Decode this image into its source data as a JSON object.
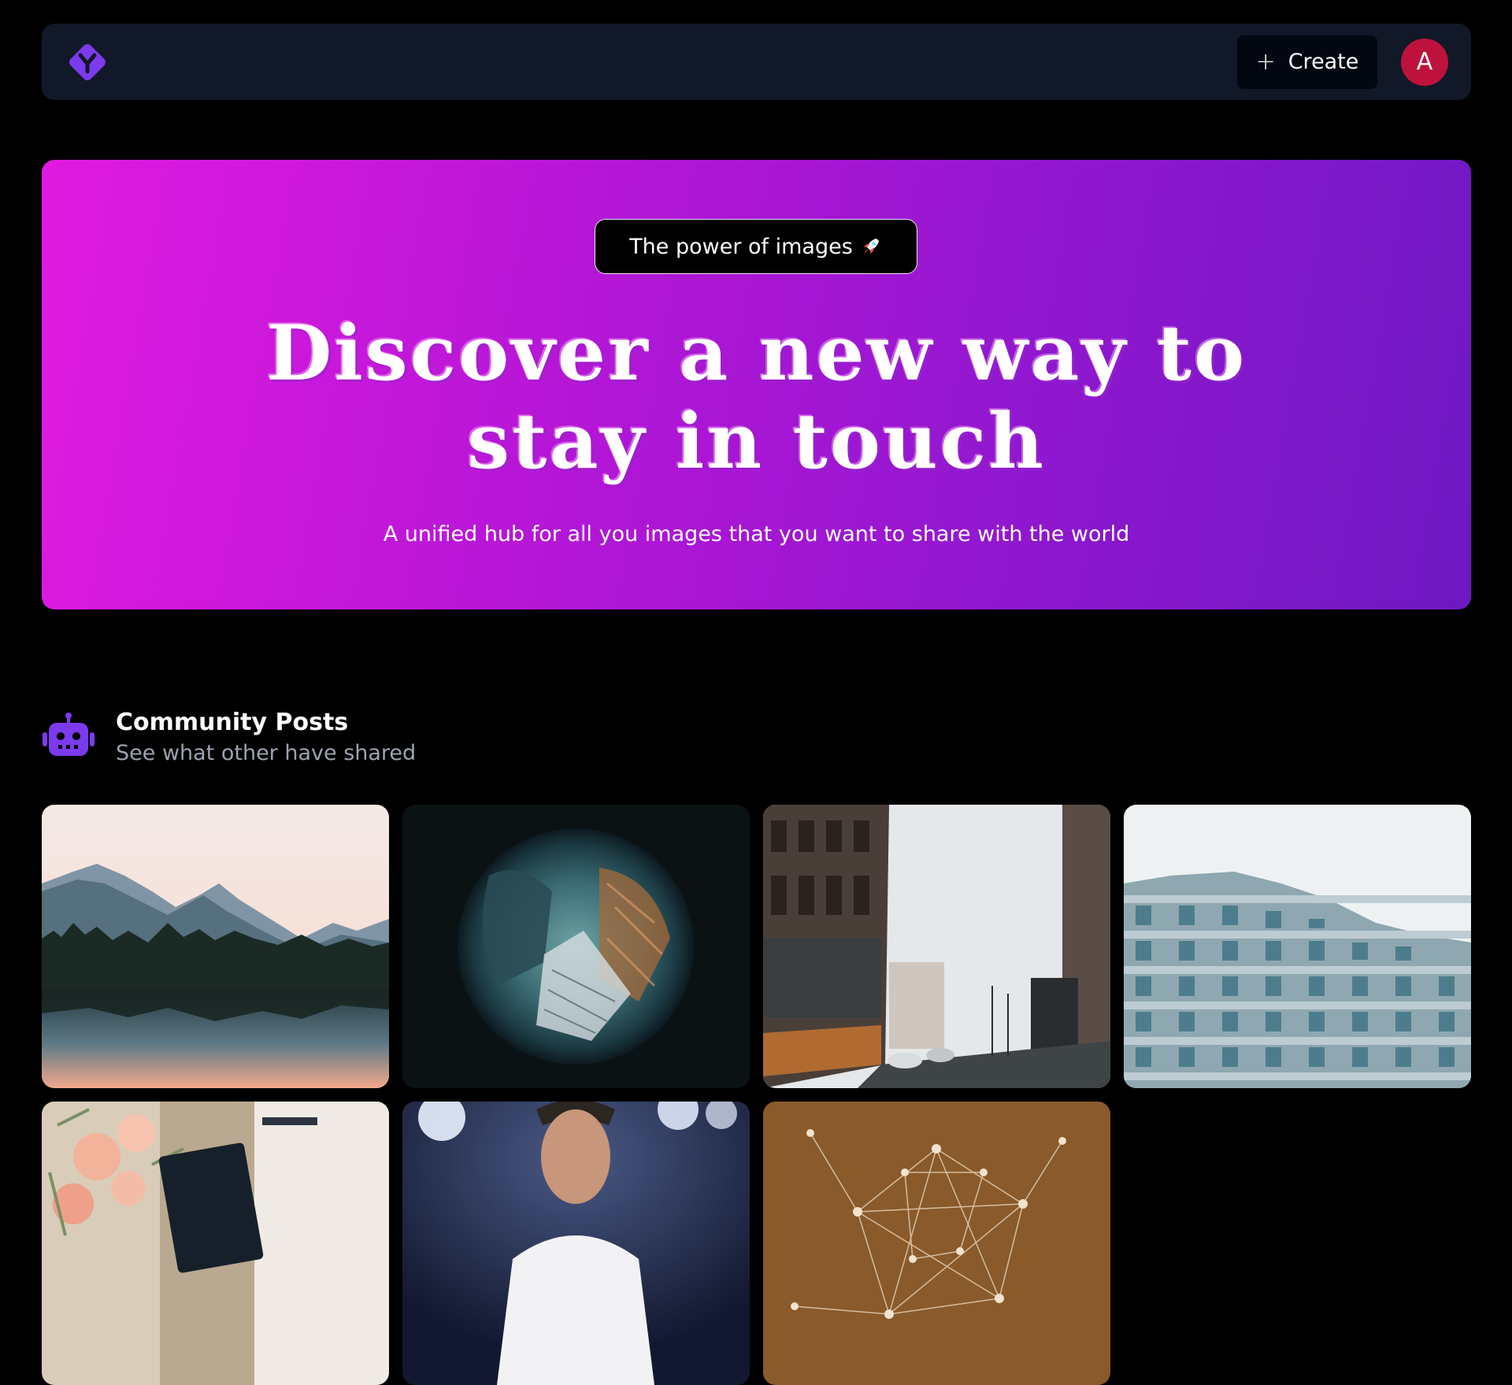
{
  "navbar": {
    "logo_icon": "logo-diamond-y-icon",
    "create_label": "Create",
    "create_icon": "plus-icon",
    "avatar_initial": "A",
    "accent": "#7c3aed",
    "avatar_color": "#be123c"
  },
  "hero": {
    "badge_label": "The power of images",
    "badge_icon": "rocket-icon",
    "title": "Discover a new way to stay in touch",
    "subtitle": "A unified hub for all you images that you want to share with the world",
    "gradient_start": "#e11ae1",
    "gradient_end": "#6d18c2"
  },
  "community": {
    "icon": "robot-icon",
    "title": "Community Posts",
    "subtitle": "See what other have shared"
  },
  "posts": [
    {
      "image": "mountain-lake-photo"
    },
    {
      "image": "fisheye-buildings-photo"
    },
    {
      "image": "snowy-street-photo"
    },
    {
      "image": "apartment-building-photo"
    },
    {
      "image": "flower-bouquet-photo"
    },
    {
      "image": "footballer-portrait-photo"
    },
    {
      "image": "network-sphere-photo"
    }
  ]
}
